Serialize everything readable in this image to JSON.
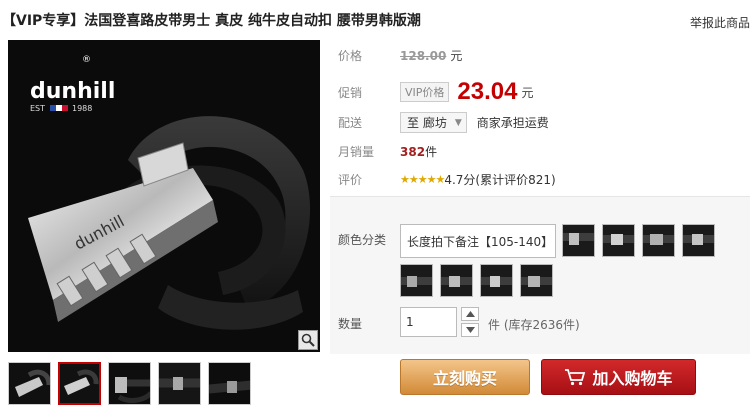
{
  "product": {
    "title": "【VIP专享】法国登喜路皮带男士 真皮 纯牛皮自动扣 腰带男韩版潮",
    "report_link": "举报此商品",
    "brand_logo_text": "dunhill",
    "brand_est": "EST",
    "brand_year": "1988"
  },
  "price": {
    "label": "价格",
    "original": "128.00",
    "unit": "元"
  },
  "promo": {
    "label": "促销",
    "vip_tag": "VIP价格",
    "price": "23.04",
    "unit": "元"
  },
  "delivery": {
    "label": "配送",
    "destination": "至 廊坊",
    "shipping_note": "商家承担运费"
  },
  "monthly_sales": {
    "label": "月销量",
    "count": "382",
    "unit": "件"
  },
  "rating": {
    "label": "评价",
    "stars": "★★★★★",
    "score_text": "4.7分(累计评价821)"
  },
  "sku": {
    "color_label": "颜色分类",
    "selected_text": "长度拍下备注【105-140】",
    "qty_label": "数量",
    "qty_value": "1",
    "stock_text": "件 (库存2636件)"
  },
  "buttons": {
    "buy_now": "立刻购买",
    "add_to_cart": "加入购物车"
  },
  "colors": {
    "price_red": "#c40000",
    "buy_orange": "#d28a37",
    "cart_red": "#b3151a",
    "star_gold": "#e0a800"
  },
  "icons": [
    "zoom-icon",
    "cart-icon",
    "caret-down-icon",
    "spin-up-icon",
    "spin-down-icon"
  ]
}
